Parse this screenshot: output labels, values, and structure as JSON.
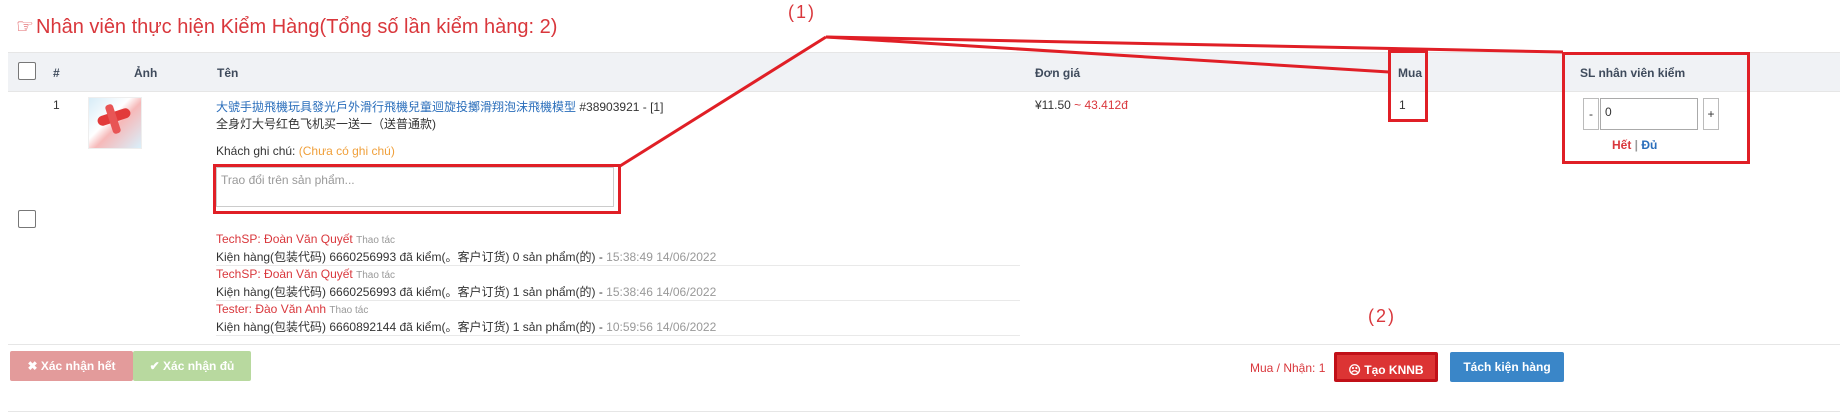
{
  "title": {
    "icon": "hand-pointing-icon",
    "text": "Nhân viên thực hiện Kiểm Hàng(Tổng số lần kiểm hàng: 2)"
  },
  "table": {
    "headers": {
      "index": "#",
      "image": "Ảnh",
      "name": "Tên",
      "unit_price": "Đơn giá",
      "buy": "Mua",
      "checked_qty": "SL nhân viên kiểm"
    }
  },
  "item": {
    "index": "1",
    "name": "大號手拋飛機玩具發光戶外滑行飛機兒童迴旋投擲滑翔泡沫飛機模型",
    "code": " #38903921 - [1]",
    "variant": "全身灯大号红色飞机买一送一（送普通款)",
    "customer_note_label": "Khách ghi chú:",
    "customer_note_value": "(Chưa có ghi chú)",
    "comment_placeholder": "Trao đổi trên sản phẩm...",
    "price_cny": "¥11.50",
    "price_vnd": " ~ 43.412đ",
    "buy_qty": "1",
    "checked_value": "0",
    "minus": "-",
    "plus": "+",
    "het": "Hết",
    "sep": " | ",
    "du": "Đủ"
  },
  "logs": [
    {
      "who": "TechSP: Đoàn Văn Quyết",
      "action": "Thao tác",
      "text": "Kiện hàng(包装代码) 6660256993 đã kiểm(。客户订货) 0 sản phẩm(的) - ",
      "time": "15:38:49 14/06/2022"
    },
    {
      "who": "TechSP: Đoàn Văn Quyết",
      "action": "Thao tác",
      "text": "Kiện hàng(包装代码) 6660256993 đã kiểm(。客户订货) 1 sản phẩm(的) - ",
      "time": "15:38:46 14/06/2022"
    },
    {
      "who": "Tester: Đào Văn Anh",
      "action": "Thao tác",
      "text": "Kiện hàng(包装代码) 6660892144 đã kiểm(。客户订货) 1 sản phẩm(的) - ",
      "time": "10:59:56 14/06/2022"
    }
  ],
  "annotations": {
    "a1": "(1)",
    "a2": "(2)"
  },
  "footer": {
    "confirm_all": "Xác nhận hết",
    "confirm_enough": "Xác nhận đủ",
    "buy_receive_label": "Mua / Nhận: 1",
    "create_knnb": "Tạo KNNB",
    "split_package": "Tách kiện hàng"
  },
  "colors": {
    "accent_red": "#d9373c",
    "link_blue": "#2a6ebb",
    "annotation_red": "#e01f26",
    "blue_button": "#3a86c8"
  }
}
